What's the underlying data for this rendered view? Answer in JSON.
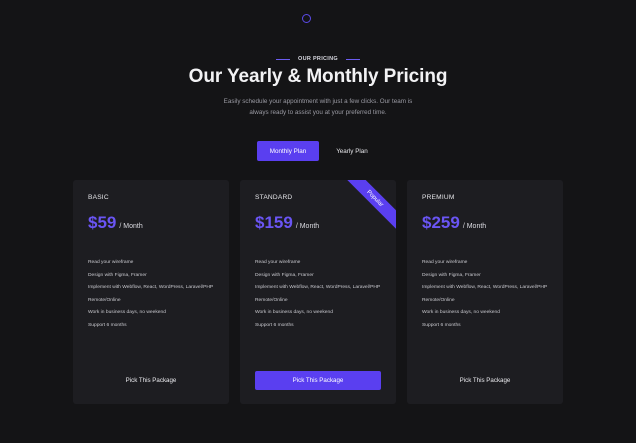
{
  "eyebrow": "OUR PRICING",
  "title": "Our Yearly & Monthly Pricing",
  "subtitle_line1": "Easily schedule your appointment with just a few clicks. Our team is",
  "subtitle_line2": "always ready to assist you at your preferred time.",
  "toggle": {
    "monthly": "Monthly Plan",
    "yearly": "Yearly Plan",
    "selected": "monthly"
  },
  "colors": {
    "accent": "#5a3ff0",
    "price": "#6a55f4",
    "background": "#141416",
    "card": "#1d1d21"
  },
  "plans": [
    {
      "name": "BASIC",
      "price": "$59",
      "period": "/ Month",
      "features": [
        "Read your wireframe",
        "Design with Figma, Framer",
        "Implement with Webflow, React, WordPress, Laravel/PHP",
        "Remote/Online",
        "Work in business days, no weekend",
        "Support 6 months"
      ],
      "cta": "Pick This Package"
    },
    {
      "name": "STANDARD",
      "price": "$159",
      "period": "/ Month",
      "badge": "Popular",
      "features": [
        "Read your wireframe",
        "Design with Figma, Framer",
        "Implement with Webflow, React, WordPress, Laravel/PHP",
        "Remote/Online",
        "Work in business days, no weekend",
        "Support 6 months"
      ],
      "cta": "Pick This Package"
    },
    {
      "name": "PREMIUM",
      "price": "$259",
      "period": "/ Month",
      "features": [
        "Read your wireframe",
        "Design with Figma, Framer",
        "Implement with Webflow, React, WordPress, Laravel/PHP",
        "Remote/Online",
        "Work in business days, no weekend",
        "Support 6 months"
      ],
      "cta": "Pick This Package"
    }
  ]
}
